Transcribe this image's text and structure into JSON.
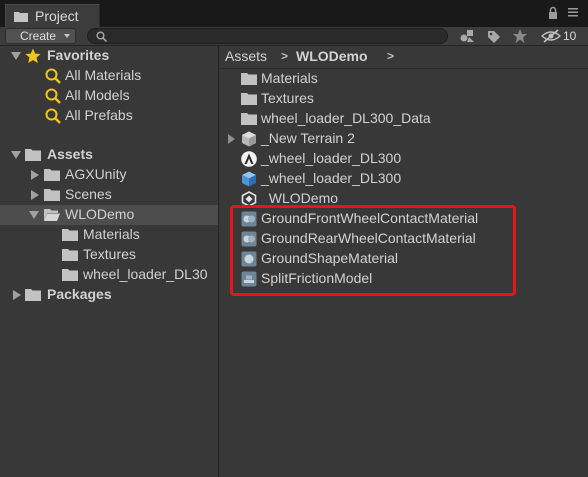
{
  "window": {
    "tab_title": "Project",
    "hidden_count": "10"
  },
  "toolbar": {
    "create_label": "Create",
    "search_placeholder": "",
    "search_value": ""
  },
  "favorites": {
    "label": "Favorites",
    "items": [
      {
        "label": "All Materials"
      },
      {
        "label": "All Models"
      },
      {
        "label": "All Prefabs"
      }
    ]
  },
  "tree": {
    "assets_label": "Assets",
    "agxunity_label": "AGXUnity",
    "scenes_label": "Scenes",
    "wlodemo_label": "WLODemo",
    "wlodemo_children": [
      {
        "label": "Materials"
      },
      {
        "label": "Textures"
      },
      {
        "label": "wheel_loader_DL30"
      }
    ],
    "packages_label": "Packages"
  },
  "breadcrumb": {
    "root": "Assets",
    "current": "WLODemo"
  },
  "content": {
    "items": [
      {
        "label": "Materials",
        "icon": "folder-icon"
      },
      {
        "label": "Textures",
        "icon": "folder-icon"
      },
      {
        "label": "wheel_loader_DL300_Data",
        "icon": "folder-icon"
      },
      {
        "label": "_New Terrain 2",
        "icon": "prefab-icon"
      },
      {
        "label": "_wheel_loader_DL300",
        "icon": "algoryx-logo-icon"
      },
      {
        "label": "_wheel_loader_DL300",
        "icon": "model-cube-icon"
      },
      {
        "label": "_WLODemo",
        "icon": "unity-scene-icon"
      },
      {
        "label": "GroundFrontWheelContactMaterial",
        "icon": "contact-material-icon"
      },
      {
        "label": "GroundRearWheelContactMaterial",
        "icon": "contact-material-icon"
      },
      {
        "label": "GroundShapeMaterial",
        "icon": "shape-material-icon"
      },
      {
        "label": "SplitFrictionModel",
        "icon": "friction-model-icon"
      }
    ]
  },
  "colors": {
    "background": "#383838",
    "highlight": "#e8141c",
    "selected_row": "#4d4d4d",
    "favorite_star": "#f0c419"
  }
}
